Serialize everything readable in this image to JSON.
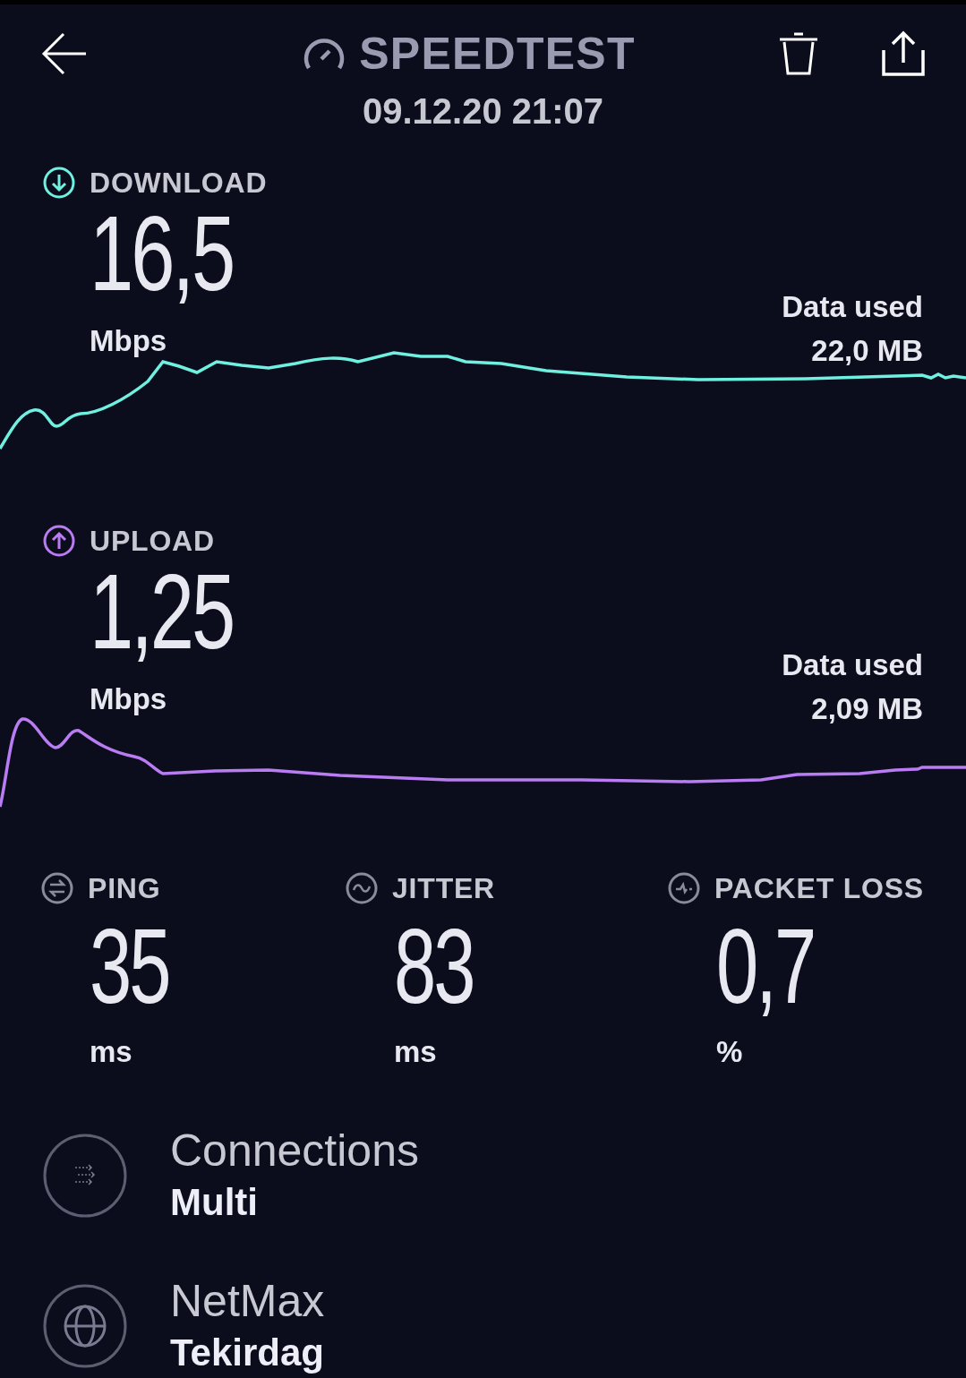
{
  "header": {
    "title": "SPEEDTEST",
    "date": "09.12.20 21:07"
  },
  "tests": [
    {
      "kind": "download",
      "label": "DOWNLOAD",
      "value": "16,5",
      "unit": "Mbps",
      "data_label": "Data used",
      "data_value": "22,0 MB",
      "color": "#6ff0e0"
    },
    {
      "kind": "upload",
      "label": "UPLOAD",
      "value": "1,25",
      "unit": "Mbps",
      "data_label": "Data used",
      "data_value": "2,09 MB",
      "color": "#b97cf2"
    }
  ],
  "metrics": [
    {
      "kind": "ping",
      "label": "PING",
      "value": "35",
      "unit": "ms"
    },
    {
      "kind": "jitter",
      "label": "JITTER",
      "value": "83",
      "unit": "ms"
    },
    {
      "kind": "packet_loss",
      "label": "PACKET LOSS",
      "value": "0,7",
      "unit": "%"
    }
  ],
  "details": [
    {
      "kind": "connections",
      "title": "Connections",
      "value": "Multi"
    },
    {
      "kind": "server",
      "title": "NetMax",
      "value": "Tekirdag"
    }
  ]
}
